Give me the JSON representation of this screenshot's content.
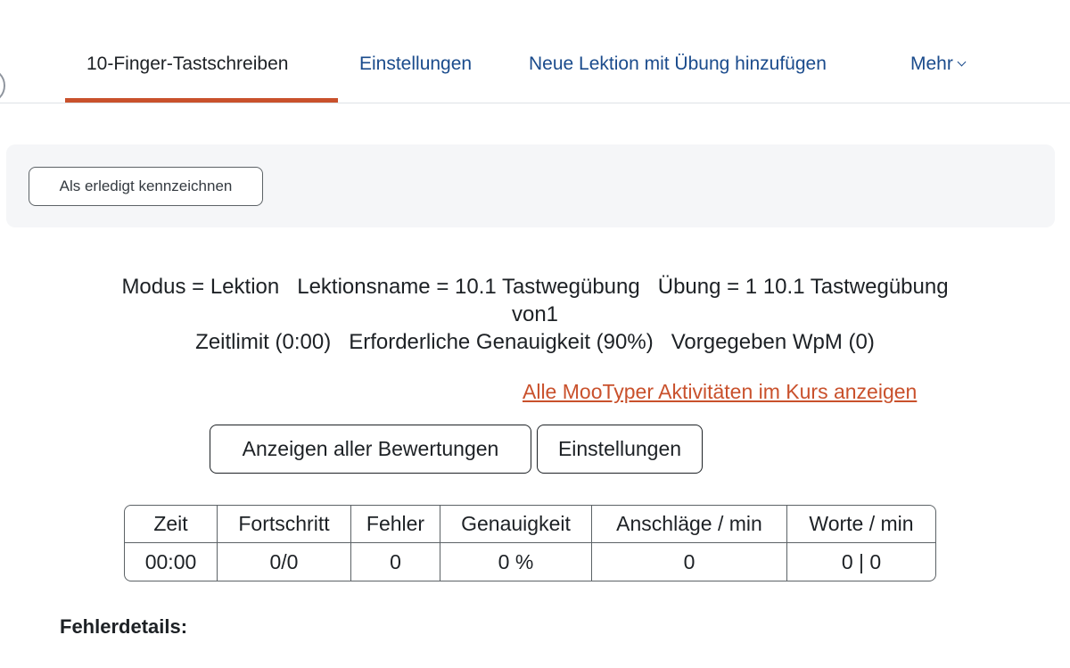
{
  "nav": {
    "items": [
      {
        "label": "10-Finger-Tastschreiben",
        "active": true
      },
      {
        "label": "Einstellungen"
      },
      {
        "label": "Neue Lektion mit Übung hinzufügen"
      },
      {
        "label": "Mehr"
      }
    ]
  },
  "completion": {
    "button_label": "Als erledigt kennzeichnen"
  },
  "info": {
    "mode": "Modus = Lektion",
    "lesson_name": "Lektionsname = 10.1 Tastwegübung",
    "exercise": "Übung = 1 10.1 Tastwegübung",
    "of": "von1",
    "time_limit": "Zeitlimit (0:00)",
    "accuracy": "Erforderliche Genauigkeit (90%)",
    "wpm": "Vorgegeben WpM (0)"
  },
  "all_activities_link": "Alle MooTyper Aktivitäten im Kurs anzeigen",
  "buttons": {
    "show_all_grades": "Anzeigen aller Bewertungen",
    "settings": "Einstellungen"
  },
  "stats": {
    "columns": [
      {
        "header": "Zeit",
        "value": "00:00"
      },
      {
        "header": "Fortschritt",
        "value": "0/0"
      },
      {
        "header": "Fehler",
        "value": "0"
      },
      {
        "header": "Genauigkeit",
        "value": "0 %"
      },
      {
        "header": "Anschläge / min",
        "value": "0"
      },
      {
        "header": "Worte / min",
        "value": "0 | 0"
      }
    ]
  },
  "error_details_label": "Fehlerdetails:",
  "colors": {
    "accent": "#c9512c",
    "link": "#1a4b8c",
    "panel_bg": "#f5f6f8"
  }
}
